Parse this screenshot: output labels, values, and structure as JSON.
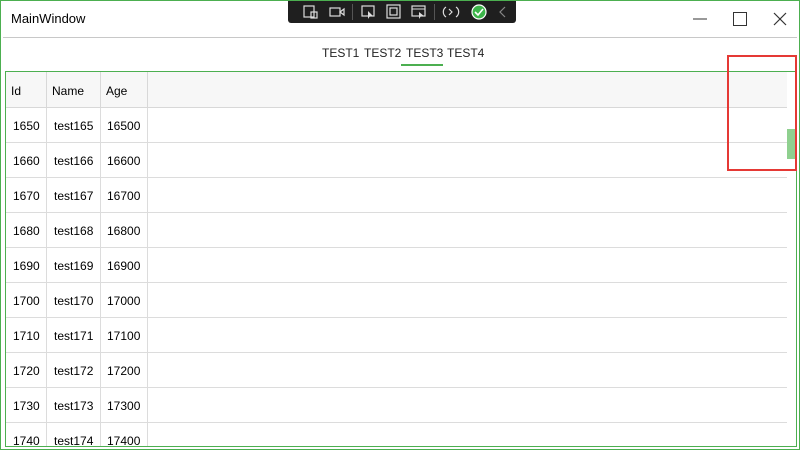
{
  "window": {
    "title": "MainWindow"
  },
  "devtools": {
    "icons": [
      "select-element-icon",
      "video-icon",
      "pointer-icon",
      "frame-icon",
      "layout-icon",
      "hot-reload-icon",
      "check-icon",
      "collapse-chevron-icon"
    ],
    "status_color": "#3cb54a"
  },
  "tabs": [
    {
      "label": "TEST1",
      "selected": false
    },
    {
      "label": "TEST2",
      "selected": false
    },
    {
      "label": "TEST3",
      "selected": true
    },
    {
      "label": "TEST4",
      "selected": false
    }
  ],
  "accent_color": "#4caf50",
  "annotation_color": "#e53935",
  "grid": {
    "columns": [
      "Id",
      "Name",
      "Age"
    ],
    "rows": [
      [
        "1650",
        "test165",
        "16500"
      ],
      [
        "1660",
        "test166",
        "16600"
      ],
      [
        "1670",
        "test167",
        "16700"
      ],
      [
        "1680",
        "test168",
        "16800"
      ],
      [
        "1690",
        "test169",
        "16900"
      ],
      [
        "1700",
        "test170",
        "17000"
      ],
      [
        "1710",
        "test171",
        "17100"
      ],
      [
        "1720",
        "test172",
        "17200"
      ],
      [
        "1730",
        "test173",
        "17300"
      ],
      [
        "1740",
        "test174",
        "17400"
      ]
    ]
  }
}
